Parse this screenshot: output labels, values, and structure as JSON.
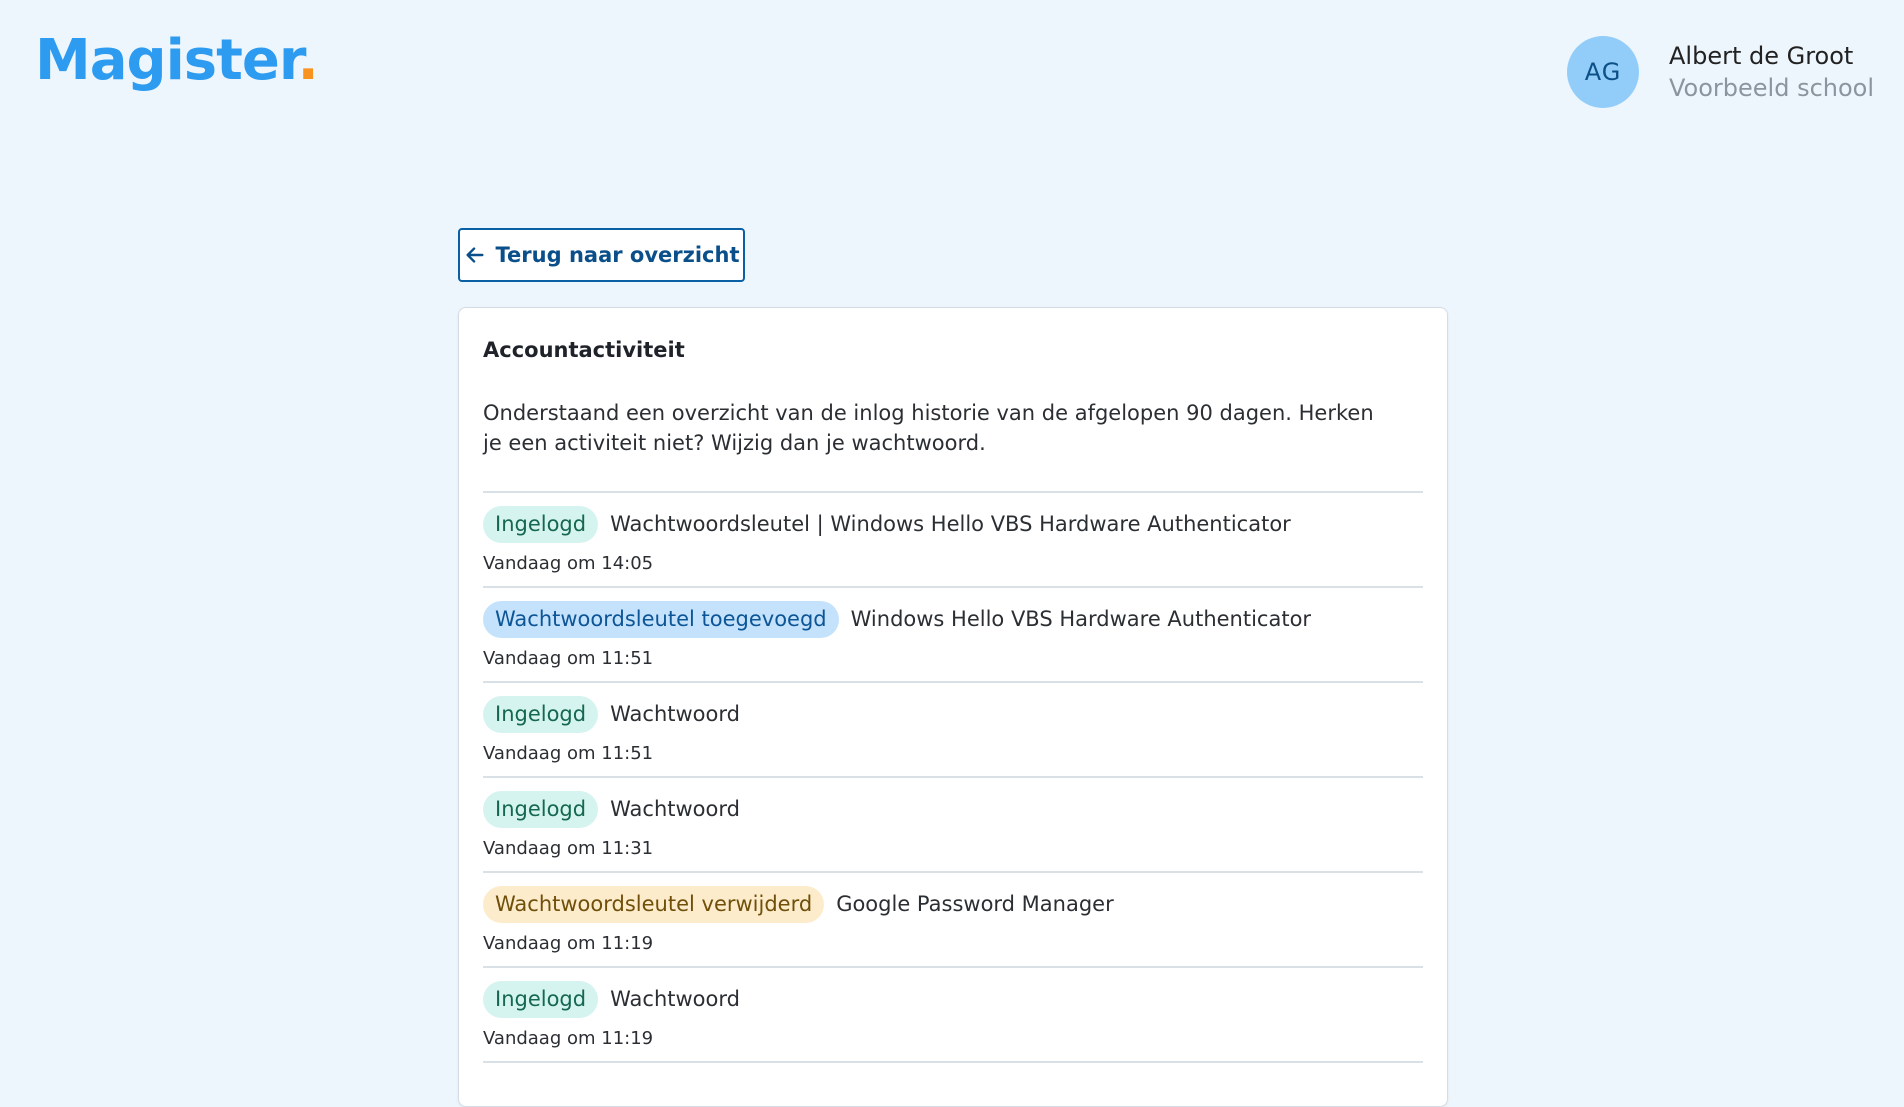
{
  "brand": {
    "name": "Magister",
    "dot": ".",
    "accent": "#2d9bf0",
    "dot_color": "#f7931e"
  },
  "user": {
    "initials": "AG",
    "name": "Albert de Groot",
    "school": "Voorbeeld school"
  },
  "back_button": {
    "label": "Terug naar overzicht",
    "icon": "arrow-left-icon"
  },
  "card": {
    "title": "Accountactiviteit",
    "description": "Onderstaand een overzicht van de inlog historie van de afgelopen 90 dagen. Herken je een activiteit niet? Wijzig dan je wachtwoord."
  },
  "activities": [
    {
      "status": "Ingelogd",
      "status_color": "green",
      "detail": "Wachtwoordsleutel | Windows Hello VBS Hardware Authenticator",
      "time": "Vandaag om 14:05"
    },
    {
      "status": "Wachtwoordsleutel toegevoegd",
      "status_color": "blue",
      "detail": "Windows Hello VBS Hardware Authenticator",
      "time": "Vandaag om 11:51"
    },
    {
      "status": "Ingelogd",
      "status_color": "green",
      "detail": "Wachtwoord",
      "time": "Vandaag om 11:51"
    },
    {
      "status": "Ingelogd",
      "status_color": "green",
      "detail": "Wachtwoord",
      "time": "Vandaag om 11:31"
    },
    {
      "status": "Wachtwoordsleutel verwijderd",
      "status_color": "yellow",
      "detail": "Google Password Manager",
      "time": "Vandaag om 11:19"
    },
    {
      "status": "Ingelogd",
      "status_color": "green",
      "detail": "Wachtwoord",
      "time": "Vandaag om 11:19"
    }
  ]
}
